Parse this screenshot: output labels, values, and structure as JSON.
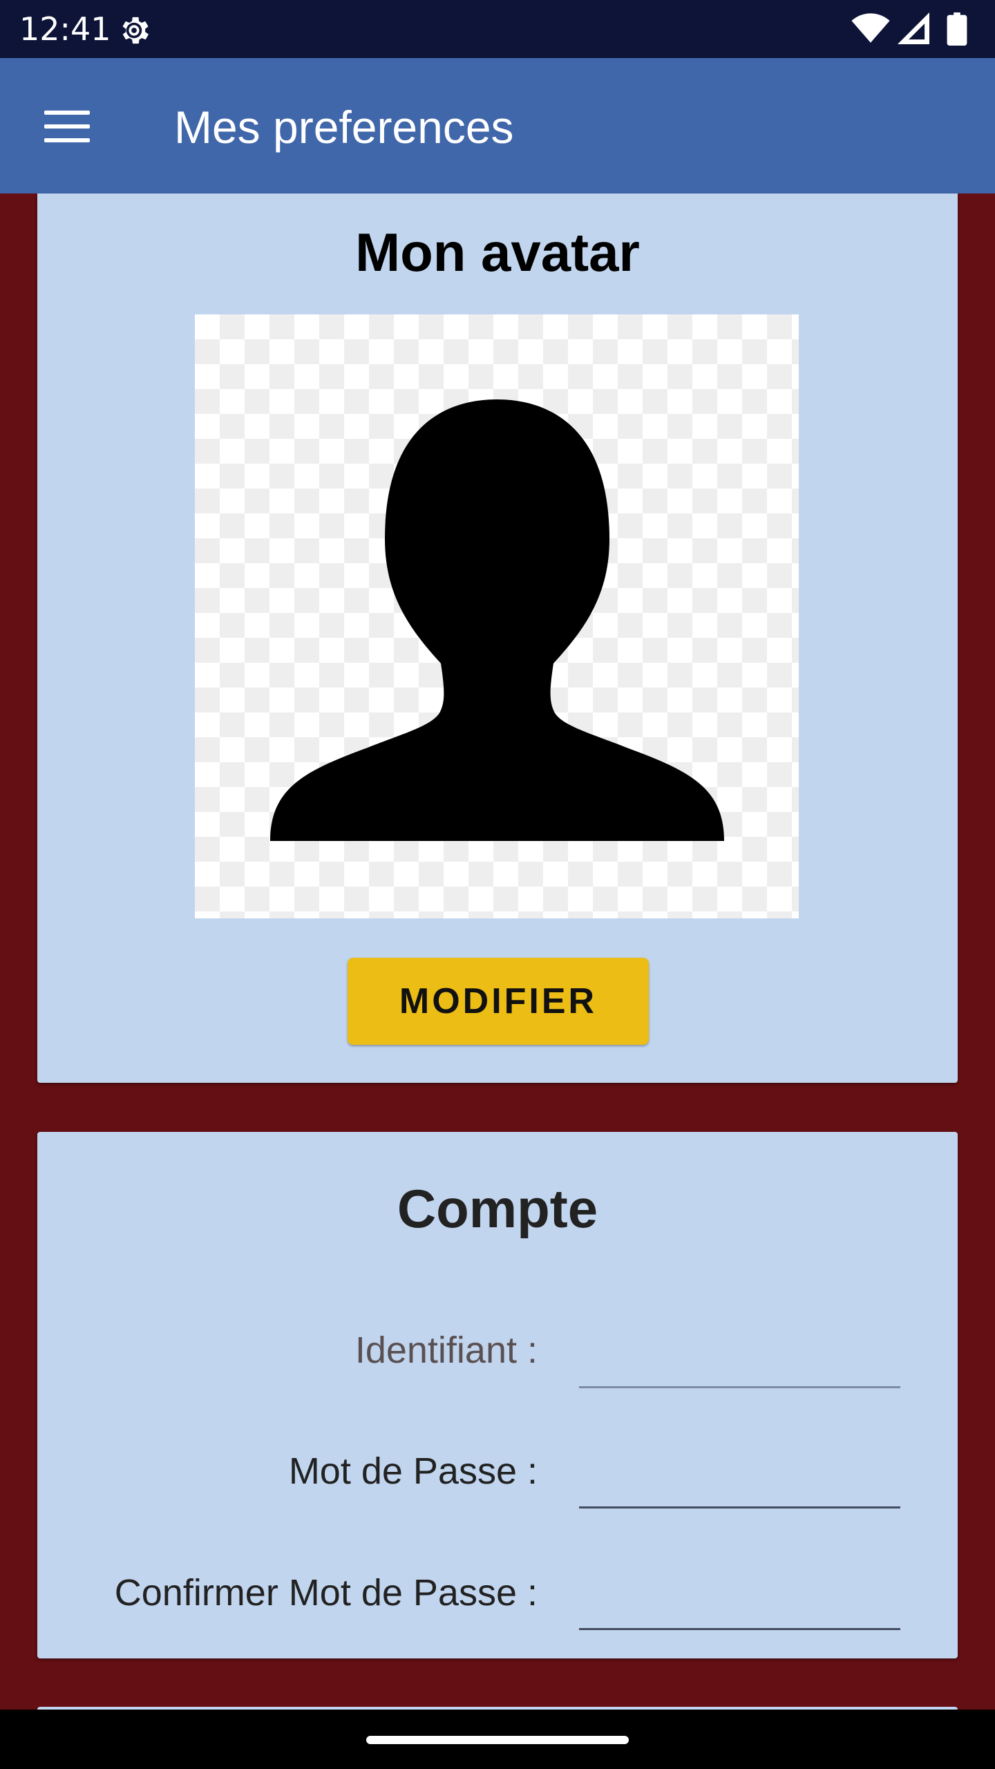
{
  "status_bar": {
    "time": "12:41",
    "icons": [
      "settings-gear-icon",
      "wifi-icon",
      "cell-signal-icon",
      "battery-icon"
    ]
  },
  "app_bar": {
    "title": "Mes preferences",
    "menu_icon": "hamburger-menu-icon"
  },
  "avatar_section": {
    "title": "Mon avatar",
    "image": "default-person-silhouette",
    "modify_button_label": "MODIFIER"
  },
  "account_section": {
    "title": "Compte",
    "fields": [
      {
        "label": "Identifiant :",
        "value": ""
      },
      {
        "label": "Mot de Passe :",
        "value": ""
      },
      {
        "label": "Confirmer Mot de Passe :",
        "value": ""
      }
    ]
  },
  "colors": {
    "background": "#630f13",
    "app_bar": "#4067aa",
    "status_bar": "#0d1437",
    "card": "#c1d5ee",
    "button": "#ecbd14"
  }
}
